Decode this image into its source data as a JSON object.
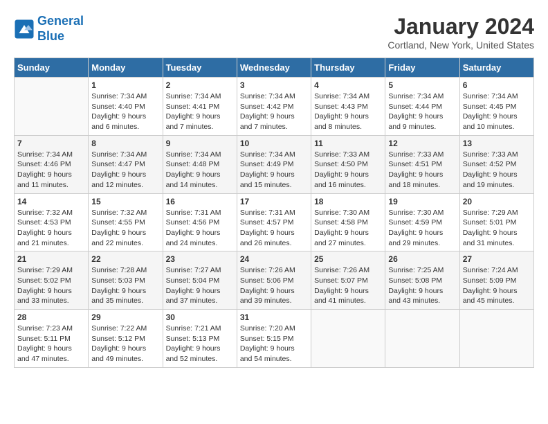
{
  "header": {
    "logo_line1": "General",
    "logo_line2": "Blue",
    "title": "January 2024",
    "subtitle": "Cortland, New York, United States"
  },
  "columns": [
    "Sunday",
    "Monday",
    "Tuesday",
    "Wednesday",
    "Thursday",
    "Friday",
    "Saturday"
  ],
  "weeks": [
    [
      {
        "day": "",
        "detail": ""
      },
      {
        "day": "1",
        "detail": "Sunrise: 7:34 AM\nSunset: 4:40 PM\nDaylight: 9 hours\nand 6 minutes."
      },
      {
        "day": "2",
        "detail": "Sunrise: 7:34 AM\nSunset: 4:41 PM\nDaylight: 9 hours\nand 7 minutes."
      },
      {
        "day": "3",
        "detail": "Sunrise: 7:34 AM\nSunset: 4:42 PM\nDaylight: 9 hours\nand 7 minutes."
      },
      {
        "day": "4",
        "detail": "Sunrise: 7:34 AM\nSunset: 4:43 PM\nDaylight: 9 hours\nand 8 minutes."
      },
      {
        "day": "5",
        "detail": "Sunrise: 7:34 AM\nSunset: 4:44 PM\nDaylight: 9 hours\nand 9 minutes."
      },
      {
        "day": "6",
        "detail": "Sunrise: 7:34 AM\nSunset: 4:45 PM\nDaylight: 9 hours\nand 10 minutes."
      }
    ],
    [
      {
        "day": "7",
        "detail": "Sunrise: 7:34 AM\nSunset: 4:46 PM\nDaylight: 9 hours\nand 11 minutes."
      },
      {
        "day": "8",
        "detail": "Sunrise: 7:34 AM\nSunset: 4:47 PM\nDaylight: 9 hours\nand 12 minutes."
      },
      {
        "day": "9",
        "detail": "Sunrise: 7:34 AM\nSunset: 4:48 PM\nDaylight: 9 hours\nand 14 minutes."
      },
      {
        "day": "10",
        "detail": "Sunrise: 7:34 AM\nSunset: 4:49 PM\nDaylight: 9 hours\nand 15 minutes."
      },
      {
        "day": "11",
        "detail": "Sunrise: 7:33 AM\nSunset: 4:50 PM\nDaylight: 9 hours\nand 16 minutes."
      },
      {
        "day": "12",
        "detail": "Sunrise: 7:33 AM\nSunset: 4:51 PM\nDaylight: 9 hours\nand 18 minutes."
      },
      {
        "day": "13",
        "detail": "Sunrise: 7:33 AM\nSunset: 4:52 PM\nDaylight: 9 hours\nand 19 minutes."
      }
    ],
    [
      {
        "day": "14",
        "detail": "Sunrise: 7:32 AM\nSunset: 4:53 PM\nDaylight: 9 hours\nand 21 minutes."
      },
      {
        "day": "15",
        "detail": "Sunrise: 7:32 AM\nSunset: 4:55 PM\nDaylight: 9 hours\nand 22 minutes."
      },
      {
        "day": "16",
        "detail": "Sunrise: 7:31 AM\nSunset: 4:56 PM\nDaylight: 9 hours\nand 24 minutes."
      },
      {
        "day": "17",
        "detail": "Sunrise: 7:31 AM\nSunset: 4:57 PM\nDaylight: 9 hours\nand 26 minutes."
      },
      {
        "day": "18",
        "detail": "Sunrise: 7:30 AM\nSunset: 4:58 PM\nDaylight: 9 hours\nand 27 minutes."
      },
      {
        "day": "19",
        "detail": "Sunrise: 7:30 AM\nSunset: 4:59 PM\nDaylight: 9 hours\nand 29 minutes."
      },
      {
        "day": "20",
        "detail": "Sunrise: 7:29 AM\nSunset: 5:01 PM\nDaylight: 9 hours\nand 31 minutes."
      }
    ],
    [
      {
        "day": "21",
        "detail": "Sunrise: 7:29 AM\nSunset: 5:02 PM\nDaylight: 9 hours\nand 33 minutes."
      },
      {
        "day": "22",
        "detail": "Sunrise: 7:28 AM\nSunset: 5:03 PM\nDaylight: 9 hours\nand 35 minutes."
      },
      {
        "day": "23",
        "detail": "Sunrise: 7:27 AM\nSunset: 5:04 PM\nDaylight: 9 hours\nand 37 minutes."
      },
      {
        "day": "24",
        "detail": "Sunrise: 7:26 AM\nSunset: 5:06 PM\nDaylight: 9 hours\nand 39 minutes."
      },
      {
        "day": "25",
        "detail": "Sunrise: 7:26 AM\nSunset: 5:07 PM\nDaylight: 9 hours\nand 41 minutes."
      },
      {
        "day": "26",
        "detail": "Sunrise: 7:25 AM\nSunset: 5:08 PM\nDaylight: 9 hours\nand 43 minutes."
      },
      {
        "day": "27",
        "detail": "Sunrise: 7:24 AM\nSunset: 5:09 PM\nDaylight: 9 hours\nand 45 minutes."
      }
    ],
    [
      {
        "day": "28",
        "detail": "Sunrise: 7:23 AM\nSunset: 5:11 PM\nDaylight: 9 hours\nand 47 minutes."
      },
      {
        "day": "29",
        "detail": "Sunrise: 7:22 AM\nSunset: 5:12 PM\nDaylight: 9 hours\nand 49 minutes."
      },
      {
        "day": "30",
        "detail": "Sunrise: 7:21 AM\nSunset: 5:13 PM\nDaylight: 9 hours\nand 52 minutes."
      },
      {
        "day": "31",
        "detail": "Sunrise: 7:20 AM\nSunset: 5:15 PM\nDaylight: 9 hours\nand 54 minutes."
      },
      {
        "day": "",
        "detail": ""
      },
      {
        "day": "",
        "detail": ""
      },
      {
        "day": "",
        "detail": ""
      }
    ]
  ]
}
